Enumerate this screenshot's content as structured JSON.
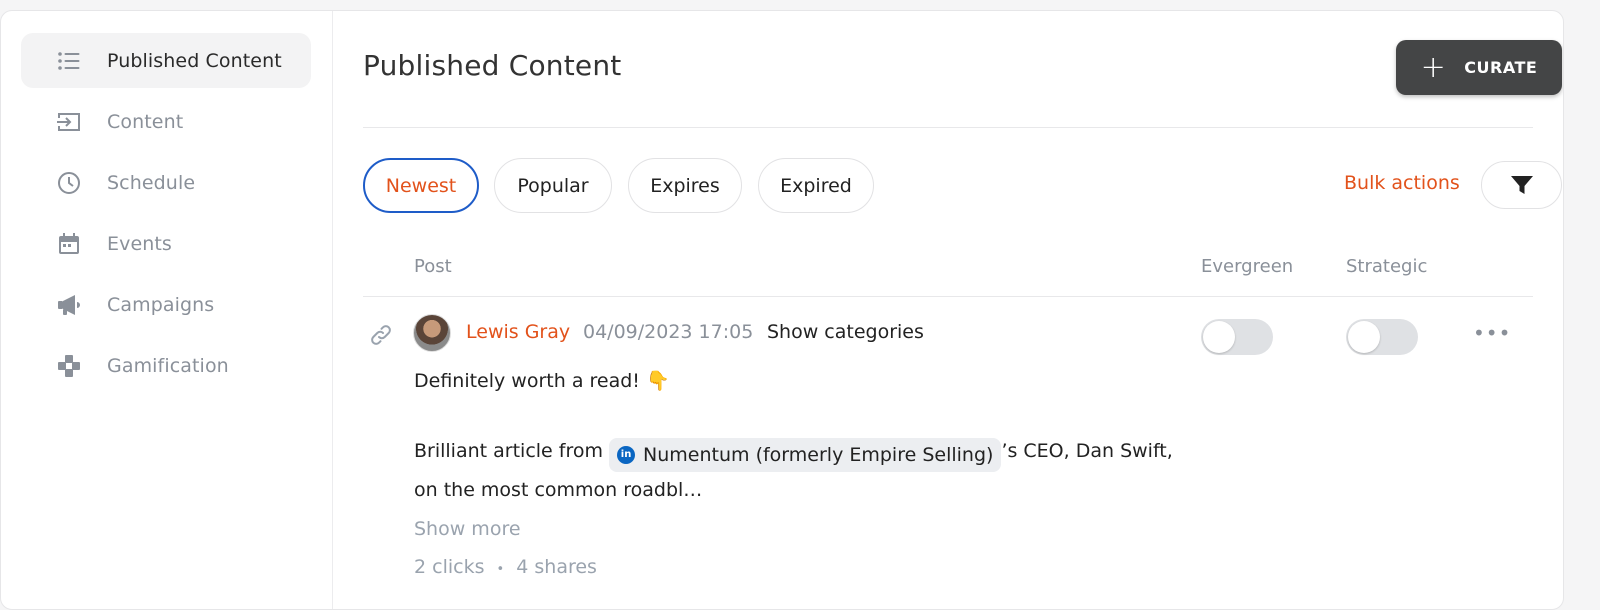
{
  "sidebar": {
    "items": [
      {
        "label": "Published Content",
        "icon": "list-icon",
        "active": true
      },
      {
        "label": "Content",
        "icon": "inbox-arrow-icon"
      },
      {
        "label": "Schedule",
        "icon": "clock-icon"
      },
      {
        "label": "Events",
        "icon": "calendar-icon"
      },
      {
        "label": "Campaigns",
        "icon": "megaphone-icon"
      },
      {
        "label": "Gamification",
        "icon": "gamepad-icon"
      }
    ]
  },
  "header": {
    "title": "Published Content",
    "curate_label": "CURATE"
  },
  "filters": {
    "chips": [
      "Newest",
      "Popular",
      "Expires",
      "Expired"
    ],
    "active": "Newest",
    "bulk_actions": "Bulk actions"
  },
  "table": {
    "columns": {
      "post": "Post",
      "evergreen": "Evergreen",
      "strategic": "Strategic"
    }
  },
  "post": {
    "author": "Lewis Gray",
    "date": "04/09/2023 17:05",
    "show_categories": "Show categories",
    "line1": "Definitely worth a read! 👇",
    "text_before": "Brilliant article from",
    "mention": "Numentum (formerly Empire Selling)",
    "mention_badge": "in",
    "text_after": "’s CEO, Dan Swift, on the most common roadbl…",
    "show_more": "Show more",
    "clicks": "2 clicks",
    "bullet": "•",
    "shares": "4 shares",
    "evergreen": false,
    "strategic": false
  },
  "colors": {
    "accent": "#e2521b",
    "active_border": "#1e5cc8",
    "button_dark": "#444546",
    "muted": "#8a9099"
  }
}
